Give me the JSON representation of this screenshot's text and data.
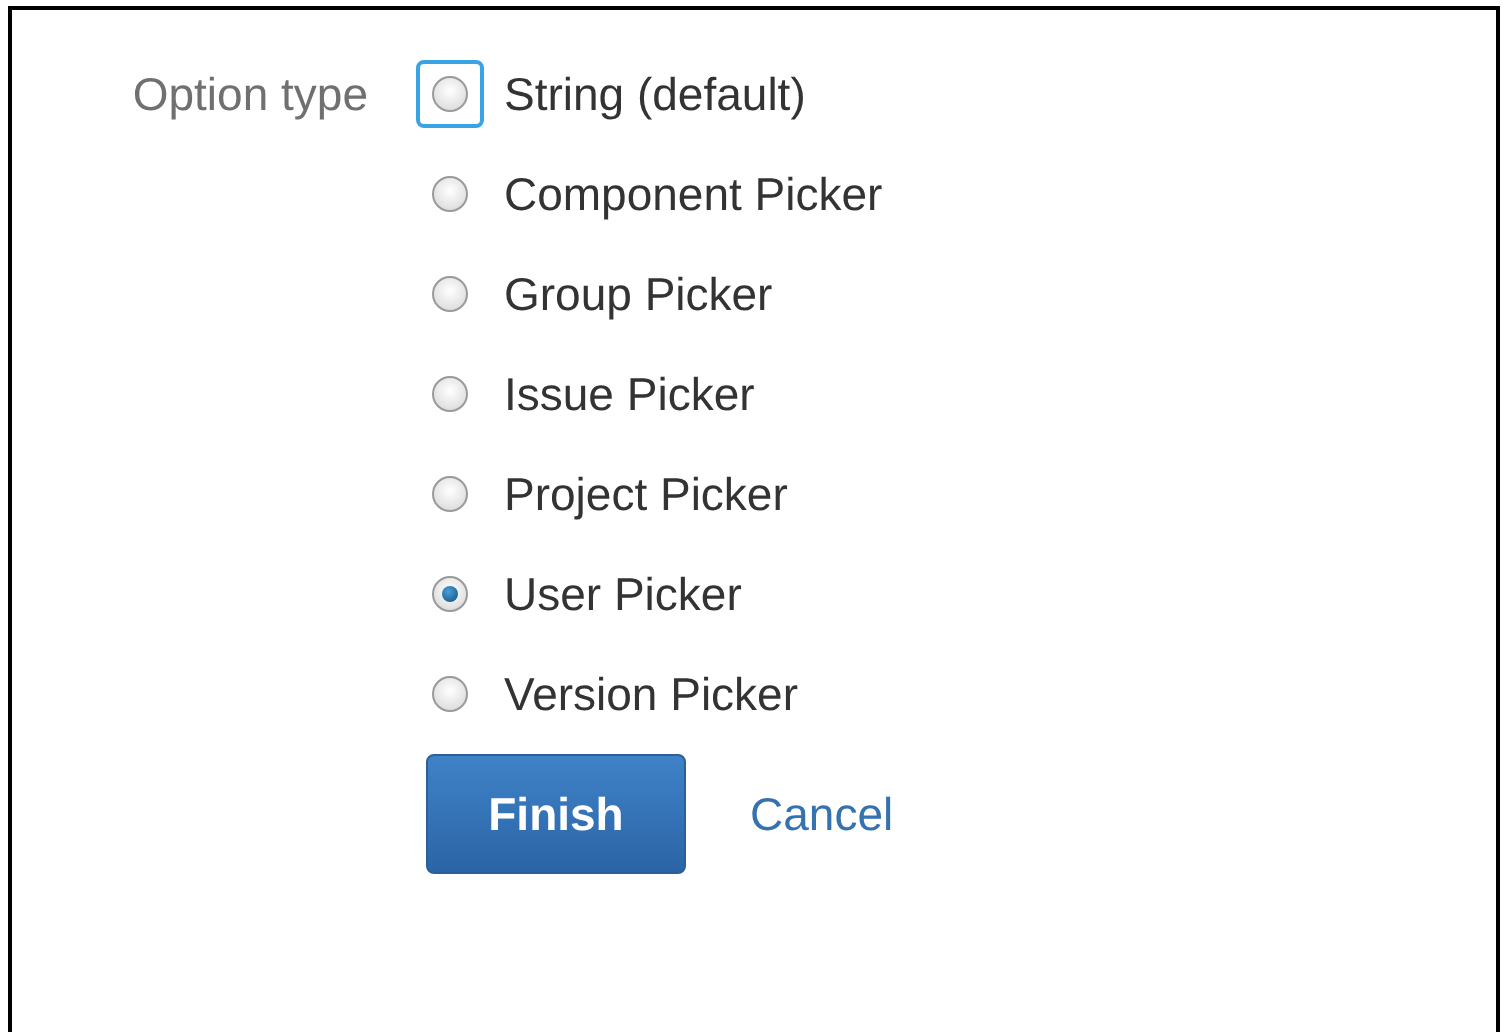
{
  "field": {
    "label": "Option type"
  },
  "options": [
    {
      "label": "String (default)",
      "selected": false,
      "focused": true
    },
    {
      "label": "Component Picker",
      "selected": false,
      "focused": false
    },
    {
      "label": "Group Picker",
      "selected": false,
      "focused": false
    },
    {
      "label": "Issue Picker",
      "selected": false,
      "focused": false
    },
    {
      "label": "Project Picker",
      "selected": false,
      "focused": false
    },
    {
      "label": "User Picker",
      "selected": true,
      "focused": false
    },
    {
      "label": "Version Picker",
      "selected": false,
      "focused": false
    }
  ],
  "buttons": {
    "primary": "Finish",
    "link": "Cancel"
  }
}
